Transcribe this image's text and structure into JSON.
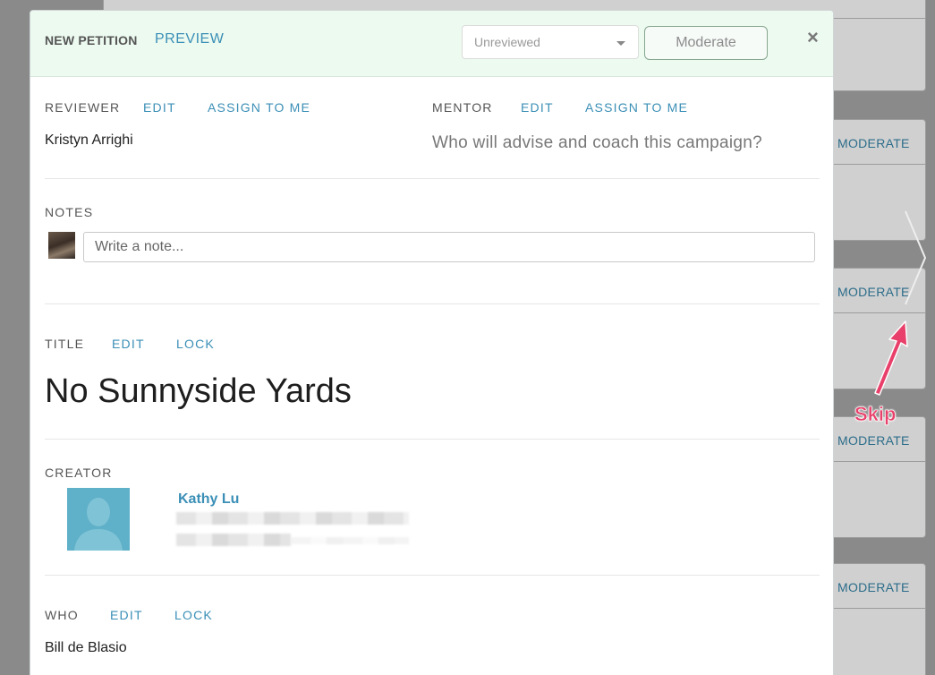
{
  "background": {
    "moderate_links": [
      "MODERATE",
      "MODERATE",
      "MODERATE",
      "MODERATE"
    ]
  },
  "header": {
    "title": "NEW PETITION",
    "preview_label": "PREVIEW",
    "status_select": {
      "selected": "Unreviewed"
    },
    "moderate_button": "Moderate",
    "close_symbol": "×"
  },
  "reviewer": {
    "label": "REVIEWER",
    "edit": "EDIT",
    "assign": "ASSIGN TO ME",
    "value": "Kristyn Arrighi"
  },
  "mentor": {
    "label": "MENTOR",
    "edit": "EDIT",
    "assign": "ASSIGN TO ME",
    "placeholder": "Who will advise and coach this campaign?"
  },
  "notes": {
    "label": "NOTES",
    "placeholder": "Write a note..."
  },
  "title_section": {
    "label": "TITLE",
    "edit": "EDIT",
    "lock": "LOCK",
    "value": "No Sunnyside Yards"
  },
  "creator": {
    "label": "CREATOR",
    "name": "Kathy Lu"
  },
  "who": {
    "label": "WHO",
    "edit": "EDIT",
    "lock": "LOCK",
    "value": "Bill de Blasio"
  },
  "annotation": {
    "skip_label": "Skip"
  },
  "colors": {
    "accent": "#3b8fb6",
    "header_bg": "#ecfaf0",
    "skip_annotation": "#e8406a"
  }
}
